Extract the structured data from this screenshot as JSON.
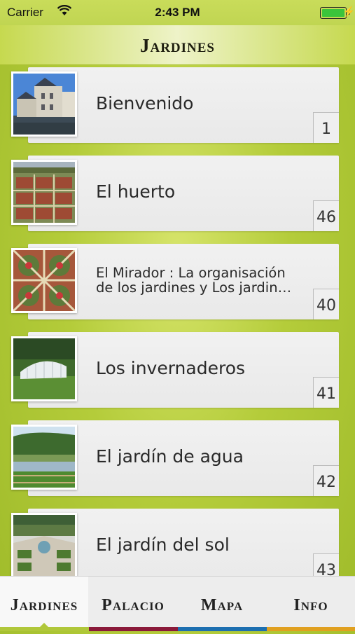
{
  "status_bar": {
    "carrier": "Carrier",
    "time": "2:43 PM",
    "battery_level": 1.0
  },
  "header": {
    "title": "Jardines"
  },
  "items": [
    {
      "title": "Bienvenido",
      "number": "1",
      "thumb": "castle-photo"
    },
    {
      "title": "El huerto",
      "number": "46",
      "thumb": "garden-aerial-photo"
    },
    {
      "title_line1": "El Mirador : La organisación",
      "title_line2": "de los jardines y Los jardin…",
      "number": "40",
      "thumb": "parterre-photo"
    },
    {
      "title": "Los invernaderos",
      "number": "41",
      "thumb": "greenhouse-photo"
    },
    {
      "title": "El jardín de agua",
      "number": "42",
      "thumb": "water-garden-photo"
    },
    {
      "title": "El jardín del sol",
      "number": "43",
      "thumb": "sun-garden-photo"
    }
  ],
  "tabs": [
    {
      "label": "Jardines",
      "active": true,
      "strip_color": "#b0c73a"
    },
    {
      "label": "Palacio",
      "active": false,
      "strip_color": "#8a1a3a"
    },
    {
      "label": "Mapa",
      "active": false,
      "strip_color": "#1d6fb0"
    },
    {
      "label": "Info",
      "active": false,
      "strip_color": "#e0a020"
    }
  ],
  "colors": {
    "accent": "#b0c73a",
    "background": "#b4cc3a"
  }
}
